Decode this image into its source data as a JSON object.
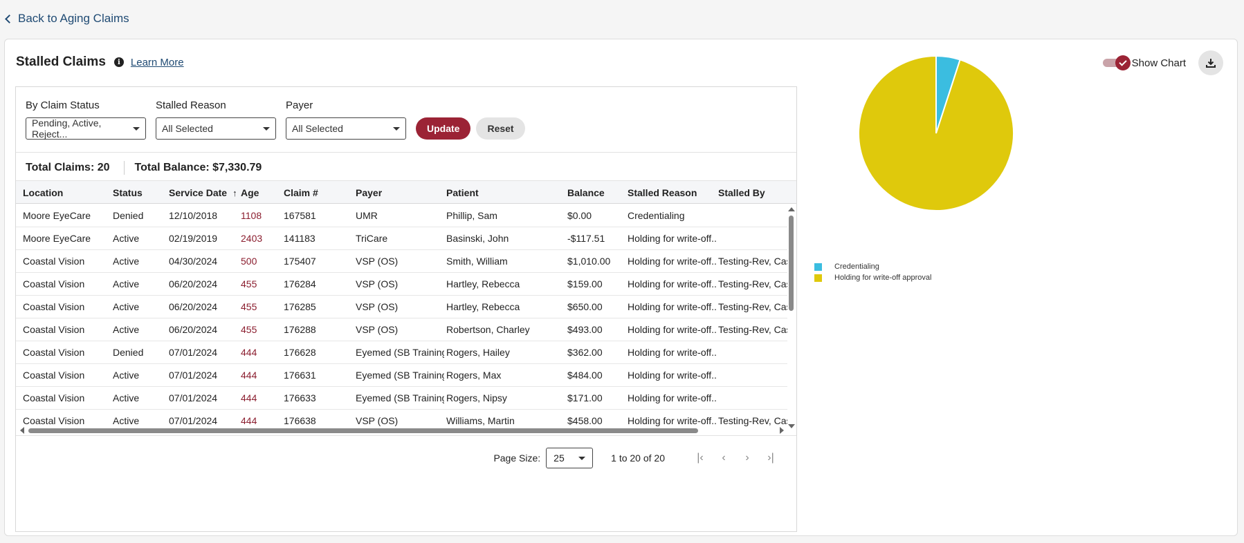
{
  "nav": {
    "back_label": "Back to Aging Claims"
  },
  "header": {
    "title": "Stalled Claims",
    "learn_more": "Learn More",
    "show_chart_label": "Show Chart"
  },
  "filters": {
    "claim_status": {
      "label": "By Claim Status",
      "value": "Pending, Active, Reject..."
    },
    "stalled_reason": {
      "label": "Stalled Reason",
      "value": "All Selected"
    },
    "payer": {
      "label": "Payer",
      "value": "All Selected"
    },
    "update_label": "Update",
    "reset_label": "Reset"
  },
  "totals": {
    "claims": "Total Claims: 20",
    "balance": "Total Balance: $7,330.79"
  },
  "table": {
    "columns": [
      "Location",
      "Status",
      "Service Date",
      "Age",
      "Claim #",
      "Payer",
      "Patient",
      "Balance",
      "Stalled Reason",
      "Stalled By"
    ],
    "sort_indicator": "↑",
    "rows": [
      [
        "Moore EyeCare",
        "Denied",
        "12/10/2018",
        "1108",
        "167581",
        "UMR",
        "Phillip, Sam",
        "$0.00",
        "Credentialing",
        ""
      ],
      [
        "Moore EyeCare",
        "Active",
        "02/19/2019",
        "2403",
        "141183",
        "TriCare",
        "Basinski, John",
        "-$117.51",
        "Holding for write-off...",
        ""
      ],
      [
        "Coastal Vision",
        "Active",
        "04/30/2024",
        "500",
        "175407",
        "VSP (OS)",
        "Smith, William",
        "$1,010.00",
        "Holding for write-off...",
        "Testing-Rev, Casey"
      ],
      [
        "Coastal Vision",
        "Active",
        "06/20/2024",
        "455",
        "176284",
        "VSP (OS)",
        "Hartley, Rebecca",
        "$159.00",
        "Holding for write-off...",
        "Testing-Rev, Casey"
      ],
      [
        "Coastal Vision",
        "Active",
        "06/20/2024",
        "455",
        "176285",
        "VSP (OS)",
        "Hartley, Rebecca",
        "$650.00",
        "Holding for write-off...",
        "Testing-Rev, Casey"
      ],
      [
        "Coastal Vision",
        "Active",
        "06/20/2024",
        "455",
        "176288",
        "VSP (OS)",
        "Robertson, Charley",
        "$493.00",
        "Holding for write-off...",
        "Testing-Rev, Casey"
      ],
      [
        "Coastal Vision",
        "Denied",
        "07/01/2024",
        "444",
        "176628",
        "Eyemed (SB Training)",
        "Rogers, Hailey",
        "$362.00",
        "Holding for write-off...",
        ""
      ],
      [
        "Coastal Vision",
        "Active",
        "07/01/2024",
        "444",
        "176631",
        "Eyemed (SB Training)",
        "Rogers, Max",
        "$484.00",
        "Holding for write-off...",
        ""
      ],
      [
        "Coastal Vision",
        "Active",
        "07/01/2024",
        "444",
        "176633",
        "Eyemed (SB Training)",
        "Rogers, Nipsy",
        "$171.00",
        "Holding for write-off...",
        ""
      ],
      [
        "Coastal Vision",
        "Active",
        "07/01/2024",
        "444",
        "176638",
        "VSP (OS)",
        "Williams, Martin",
        "$458.00",
        "Holding for write-off...",
        "Testing-Rev, Casey"
      ]
    ]
  },
  "pager": {
    "page_size_label": "Page Size:",
    "page_size": "25",
    "range": "1 to 20 of 20"
  },
  "chart_data": {
    "type": "pie",
    "slices": [
      {
        "name": "Credentialing",
        "value": 1,
        "color": "#3bbde0"
      },
      {
        "name": "Holding for write-off approval",
        "value": 19,
        "color": "#dfc90c"
      }
    ]
  },
  "colors": {
    "accent": "#9b2335",
    "link": "#1f4a73"
  }
}
